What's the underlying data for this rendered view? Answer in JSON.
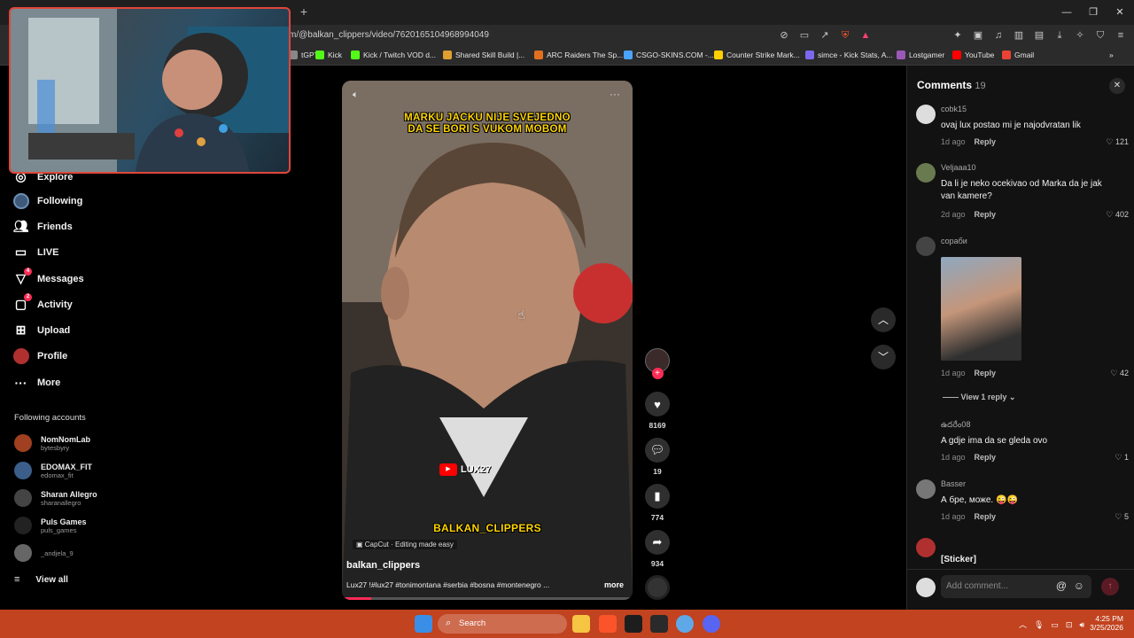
{
  "browser": {
    "url": "m/@balkan_clippers/video/7620165104968994049",
    "new_tab": "+",
    "bookmarks": [
      {
        "label": "tGPT",
        "color": "#888888"
      },
      {
        "label": "Kick",
        "color": "#53fc18"
      },
      {
        "label": "Kick / Twitch VOD d...",
        "color": "#53fc18"
      },
      {
        "label": "Shared Skill Build |...",
        "color": "#e0a030"
      },
      {
        "label": "ARC Raiders The Sp...",
        "color": "#e07020"
      },
      {
        "label": "CSGO-SKINS.COM -...",
        "color": "#4aa3ff"
      },
      {
        "label": "Counter Strike Mark...",
        "color": "#ffd000"
      },
      {
        "label": "simce - Kick Stats, A...",
        "color": "#7b68ee"
      },
      {
        "label": "Lostgamer",
        "color": "#9b59b6"
      },
      {
        "label": "YouTube",
        "color": "#ff0000"
      },
      {
        "label": "Gmail",
        "color": "#ea4335"
      }
    ]
  },
  "sidebar": {
    "nav": [
      {
        "label": "Explore",
        "icon": "compass-icon"
      },
      {
        "label": "Following",
        "icon": "following-icon"
      },
      {
        "label": "Friends",
        "icon": "friends-icon"
      },
      {
        "label": "LIVE",
        "icon": "live-icon"
      },
      {
        "label": "Messages",
        "icon": "messages-icon",
        "badge": "4"
      },
      {
        "label": "Activity",
        "icon": "activity-icon",
        "badge": "2"
      },
      {
        "label": "Upload",
        "icon": "upload-icon"
      },
      {
        "label": "Profile",
        "icon": "profile-icon"
      },
      {
        "label": "More",
        "icon": "more-icon"
      }
    ],
    "following_title": "Following accounts",
    "accounts": [
      {
        "name": "NomNomLab",
        "handle": "bytesbyry",
        "color": "#a04020"
      },
      {
        "name": "EDOMAX_FIT",
        "handle": "edomax_fit",
        "color": "#3b5f8a"
      },
      {
        "name": "Sharan Allegro",
        "handle": "sharanallegro",
        "color": "#444444"
      },
      {
        "name": "Puls Games",
        "handle": "puls_games",
        "color": "#222222"
      },
      {
        "name": "",
        "handle": "_andjela_9",
        "color": "#666666"
      }
    ],
    "view_all": "View all"
  },
  "video": {
    "caption_top_1": "MARKU JACKU NIJE SVEJEDNO",
    "caption_top_2": "DA SE BORI S VUKOM MOBOM",
    "logo_text": "LUX27",
    "caption_bottom": "BALKAN_CLIPPERS",
    "capcut": "CapCut · Editing made easy",
    "author": "balkan_clippers",
    "description": "Lux27 !#lux27 #tonimontana #serbia #bosna #montenegro ...",
    "more": "more",
    "progress": 0.1
  },
  "actions": {
    "likes": "8169",
    "comments": "19",
    "saves": "774",
    "shares": "934"
  },
  "comments_panel": {
    "title": "Comments",
    "count": "19",
    "items": [
      {
        "user": "cobk15",
        "text": "ovaj lux postao mi je najodvratan lik",
        "age": "1d ago",
        "reply": "Reply",
        "likes": "121"
      },
      {
        "user": "Veljaaa10",
        "text": "Da li je neko ocekivao od Marka da je jak van kamere?",
        "age": "2d ago",
        "reply": "Reply",
        "likes": "402"
      },
      {
        "user": "сораби",
        "text": "",
        "age": "1d ago",
        "reply": "Reply",
        "likes": "42",
        "view_replies": "View 1 reply"
      },
      {
        "user": "ఉదరేం08",
        "text": "A gdje ima da se gleda ovo",
        "age": "1d ago",
        "reply": "Reply",
        "likes": "1"
      },
      {
        "user": "Basser",
        "text": "А бре, може. 😜😜",
        "age": "1d ago",
        "reply": "Reply",
        "likes": "5"
      },
      {
        "user": "",
        "text": "[Sticker]",
        "age": "",
        "reply": "",
        "likes": ""
      }
    ],
    "add_placeholder": "Add comment..."
  },
  "taskbar": {
    "search": "Search",
    "time": "4:25 PM",
    "date": "3/25/2026"
  }
}
